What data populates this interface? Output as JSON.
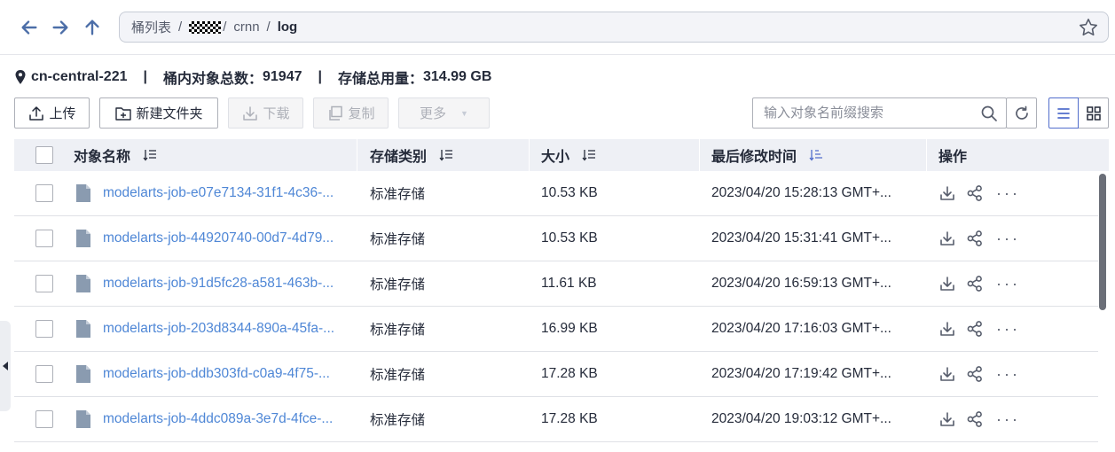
{
  "breadcrumb": {
    "root": "桶列表",
    "separator": "/",
    "masked_segment": "",
    "folder": "crnn",
    "current": "log"
  },
  "info": {
    "region": "cn-central-221",
    "divider": "|",
    "object_count_label": "桶内对象总数：",
    "object_count": "91947",
    "storage_label": "存储总用量：",
    "storage_value": "314.99 GB"
  },
  "toolbar": {
    "upload": "上传",
    "new_folder": "新建文件夹",
    "download": "下载",
    "copy": "复制",
    "more": "更多"
  },
  "search": {
    "placeholder": "输入对象名前缀搜索"
  },
  "table": {
    "headers": {
      "name": "对象名称",
      "storage_class": "存储类别",
      "size": "大小",
      "modified": "最后修改时间",
      "actions": "操作"
    },
    "rows": [
      {
        "name": "modelarts-job-e07e7134-31f1-4c36-...",
        "storage_class": "标准存储",
        "size": "10.53 KB",
        "modified": "2023/04/20 15:28:13 GMT+..."
      },
      {
        "name": "modelarts-job-44920740-00d7-4d79...",
        "storage_class": "标准存储",
        "size": "10.53 KB",
        "modified": "2023/04/20 15:31:41 GMT+..."
      },
      {
        "name": "modelarts-job-91d5fc28-a581-463b-...",
        "storage_class": "标准存储",
        "size": "11.61 KB",
        "modified": "2023/04/20 16:59:13 GMT+..."
      },
      {
        "name": "modelarts-job-203d8344-890a-45fa-...",
        "storage_class": "标准存储",
        "size": "16.99 KB",
        "modified": "2023/04/20 17:16:03 GMT+..."
      },
      {
        "name": "modelarts-job-ddb303fd-c0a9-4f75-...",
        "storage_class": "标准存储",
        "size": "17.28 KB",
        "modified": "2023/04/20 17:19:42 GMT+..."
      },
      {
        "name": "modelarts-job-4ddc089a-3e7d-4fce-...",
        "storage_class": "标准存储",
        "size": "17.28 KB",
        "modified": "2023/04/20 19:03:12 GMT+..."
      }
    ],
    "more_actions": "···"
  },
  "icons": {
    "back": "arrow-left-icon",
    "forward": "arrow-right-icon",
    "up": "arrow-up-icon",
    "favorite": "star-icon",
    "location": "location-pin-icon",
    "file": "file-icon",
    "download": "download-icon",
    "share": "share-icon"
  },
  "colors": {
    "accent": "#526ecc",
    "link": "#4f87d6",
    "nav_arrow": "#526ecc",
    "header_bg": "#eef0f5"
  }
}
